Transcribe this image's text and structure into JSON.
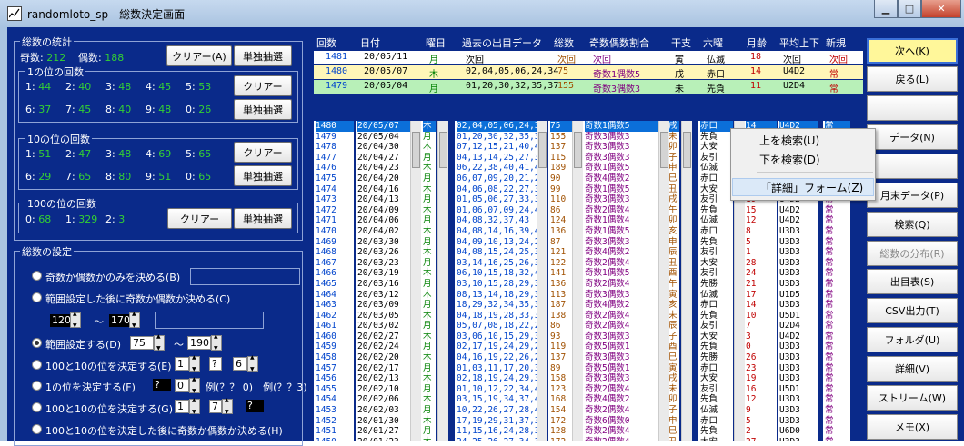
{
  "window": {
    "title": "randomloto_sp　総数決定画面"
  },
  "stats": {
    "group_title": "総数の統計",
    "odd_label": "奇数:",
    "odd_value": "212",
    "even_label": "偶数:",
    "even_value": "188",
    "clear_label": "クリアー(A)",
    "single_label": "単独抽選",
    "ones_title": "1の位の回数",
    "ones_row1": [
      [
        "1:",
        "44"
      ],
      [
        "2:",
        "40"
      ],
      [
        "3:",
        "48"
      ],
      [
        "4:",
        "45"
      ],
      [
        "5:",
        "53"
      ]
    ],
    "ones_row2": [
      [
        "6:",
        "37"
      ],
      [
        "7:",
        "45"
      ],
      [
        "8:",
        "40"
      ],
      [
        "9:",
        "48"
      ],
      [
        "0:",
        "26"
      ]
    ],
    "tens_title": "10の位の回数",
    "tens_row1": [
      [
        "1:",
        "51"
      ],
      [
        "2:",
        "47"
      ],
      [
        "3:",
        "48"
      ],
      [
        "4:",
        "69"
      ],
      [
        "5:",
        "65"
      ]
    ],
    "tens_row2": [
      [
        "6:",
        "29"
      ],
      [
        "7:",
        "65"
      ],
      [
        "8:",
        "80"
      ],
      [
        "9:",
        "51"
      ],
      [
        "0:",
        "65"
      ]
    ],
    "hund_title": "100の位の回数",
    "hund_row": [
      [
        "0:",
        "68"
      ],
      [
        "1:",
        "329"
      ],
      [
        "2:",
        "3"
      ]
    ],
    "clear2_label": "クリアー"
  },
  "settings": {
    "group_title": "総数の設定",
    "opt1": "奇数か偶数かのみを決める(B)",
    "opt2": "範囲設定した後に奇数か偶数か決める(C)",
    "opt2_from": "120",
    "opt2_to": "170",
    "tilde": "～",
    "opt3": "範囲設定する(D)",
    "opt3_from": "75",
    "opt3_to": "190",
    "opt4": "100と10の位を決定する(E)",
    "opt4_a": "1",
    "opt4_b": "?",
    "opt4_c": "6",
    "opt5": "1の位を決定する(F)",
    "opt5_a": "?",
    "opt5_b": "0",
    "opt5_ex": "例(？？ 0)　例(？？3)",
    "opt6": "100と10の位を決定する(G)",
    "opt6_a": "1",
    "opt6_b": "7",
    "opt6_c": "?",
    "opt7": "100と10の位を決定した後に奇数か偶数か決める(H)"
  },
  "headers": [
    "回数",
    "日付",
    "曜日",
    "過去の出目データ",
    "総数",
    "奇数偶数割合",
    "干支",
    "六曜",
    "月齢",
    "平均上下",
    "新規"
  ],
  "top_rows": [
    {
      "no": "1481",
      "date": "20/05/11",
      "wd": "月",
      "data": "次回",
      "sum": "次回",
      "ratio": "次回",
      "eto": "寅",
      "rokuyo": "仏滅",
      "age": "18",
      "avg": "次回",
      "new": "次回",
      "bg": "#ffffff"
    },
    {
      "no": "1480",
      "date": "20/05/07",
      "wd": "木",
      "data": "02,04,05,06,24,34",
      "sum": "75",
      "ratio": "奇数1偶数5",
      "eto": "戌",
      "rokuyo": "赤口",
      "age": "14",
      "avg": "U4D2",
      "new": "常",
      "bg": "#fff6b8"
    },
    {
      "no": "1479",
      "date": "20/05/04",
      "wd": "月",
      "data": "01,20,30,32,35,37",
      "sum": "155",
      "ratio": "奇数3偶数3",
      "eto": "未",
      "rokuyo": "先負",
      "age": "11",
      "avg": "U2D4",
      "new": "常",
      "bg": "#b8f0b8"
    }
  ],
  "list": {
    "no": [
      "1480",
      "1479",
      "1478",
      "1477",
      "1476",
      "1475",
      "1474",
      "1473",
      "1472",
      "1471",
      "1470",
      "1469",
      "1468",
      "1467",
      "1466",
      "1465",
      "1464",
      "1463",
      "1462",
      "1461",
      "1460",
      "1459",
      "1458",
      "1457",
      "1456",
      "1455",
      "1454",
      "1453",
      "1452",
      "1451",
      "1450",
      "1449"
    ],
    "date": [
      "20/05/07",
      "20/05/04",
      "20/04/30",
      "20/04/27",
      "20/04/23",
      "20/04/20",
      "20/04/16",
      "20/04/13",
      "20/04/09",
      "20/04/06",
      "20/04/02",
      "20/03/30",
      "20/03/26",
      "20/03/23",
      "20/03/19",
      "20/03/16",
      "20/03/12",
      "20/03/09",
      "20/03/05",
      "20/03/02",
      "20/02/27",
      "20/02/24",
      "20/02/20",
      "20/02/17",
      "20/02/13",
      "20/02/10",
      "20/02/06",
      "20/02/03",
      "20/01/30",
      "20/01/27",
      "20/01/23",
      "20/01/20"
    ],
    "wd": [
      "木",
      "月",
      "木",
      "月",
      "木",
      "月",
      "木",
      "月",
      "木",
      "月",
      "木",
      "月",
      "木",
      "月",
      "木",
      "月",
      "木",
      "月",
      "木",
      "月",
      "木",
      "月",
      "木",
      "月",
      "木",
      "月",
      "木",
      "月",
      "木",
      "月",
      "木",
      "月"
    ],
    "data": [
      "02,04,05,06,24,34",
      "01,20,30,32,35,37",
      "07,12,15,21,40,42",
      "04,13,14,25,27,32",
      "06,22,38,40,41,42",
      "06,07,09,20,21,27",
      "04,06,08,22,27,32",
      "01,05,06,27,33,38",
      "01,06,07,09,24,40",
      "04,08,32,37,43",
      "04,08,14,16,39,40",
      "04,09,10,13,24,27",
      "04,08,15,24,25,31",
      "03,14,16,25,26,38",
      "06,10,15,18,32,40",
      "03,10,15,28,29,30",
      "08,13,14,18,29,31",
      "18,29,32,34,35,39",
      "04,18,19,28,33,36",
      "05,07,08,18,22,26",
      "03,06,10,15,29,30",
      "02,17,19,24,29,29",
      "04,16,19,22,26,29",
      "01,03,11,17,20,37",
      "02,18,19,24,29,31",
      "01,10,12,22,34,43",
      "03,15,19,34,37,40",
      "10,22,26,27,28,41",
      "17,19,29,31,37,39",
      "11,15,16,24,28,34",
      "24,25,26,27,34,36",
      "04,05,07,16,27,40"
    ],
    "sum": [
      "75",
      "155",
      "137",
      "115",
      "189",
      "90",
      "99",
      "110",
      "86",
      "124",
      "136",
      "87",
      "121",
      "122",
      "141",
      "136",
      "113",
      "187",
      "138",
      "86",
      "93",
      "119",
      "137",
      "89",
      "158",
      "123",
      "168",
      "154",
      "172",
      "128",
      "172",
      "99"
    ],
    "ratio": [
      "奇数1偶数5",
      "奇数3偶数3",
      "奇数3偶数3",
      "奇数3偶数3",
      "奇数1偶数5",
      "奇数4偶数2",
      "奇数1偶数5",
      "奇数3偶数3",
      "奇数2偶数4",
      "奇数1偶数4",
      "奇数1偶数5",
      "奇数3偶数3",
      "奇数4偶数2",
      "奇数2偶数4",
      "奇数1偶数5",
      "奇数2偶数4",
      "奇数3偶数3",
      "奇数4偶数2",
      "奇数2偶数4",
      "奇数2偶数4",
      "奇数3偶数3",
      "奇数5偶数1",
      "奇数3偶数3",
      "奇数5偶数1",
      "奇数3偶数3",
      "奇数2偶数4",
      "奇数4偶数2",
      "奇数2偶数4",
      "奇数6偶数0",
      "奇数2偶数4",
      "奇数2偶数4",
      "奇数3偶数3"
    ],
    "eto": [
      "戌",
      "未",
      "卯",
      "子",
      "申",
      "巳",
      "丑",
      "戌",
      "午",
      "卯",
      "亥",
      "申",
      "辰",
      "丑",
      "酉",
      "午",
      "寅",
      "亥",
      "未",
      "辰",
      "子",
      "酉",
      "巳",
      "寅",
      "戌",
      "未",
      "卯",
      "子",
      "申",
      "巳",
      "丑",
      "戌"
    ],
    "rokuyo": [
      "赤口",
      "先負",
      "大安",
      "友引",
      "仏滅",
      "赤口",
      "大安",
      "友引",
      "先負",
      "仏滅",
      "赤口",
      "先負",
      "友引",
      "大安",
      "友引",
      "先勝",
      "仏滅",
      "赤口",
      "先負",
      "友引",
      "大安",
      "先負",
      "先勝",
      "赤口",
      "大安",
      "友引",
      "先負",
      "仏滅",
      "赤口",
      "先負",
      "大安",
      "友引"
    ],
    "age": [
      "14",
      "11",
      "7",
      "4",
      "0",
      "26",
      "22",
      "19",
      "15",
      "12",
      "8",
      "5",
      "1",
      "28",
      "24",
      "21",
      "17",
      "14",
      "10",
      "7",
      "3",
      "0",
      "26",
      "23",
      "19",
      "16",
      "12",
      "9",
      "5",
      "2",
      "27",
      "24"
    ],
    "avg": [
      "U4D2",
      "U2D4",
      "U2D4",
      "U4D2",
      "U4D2",
      "U4D2",
      "U4D2",
      "U4D2",
      "U4D2",
      "U4D2",
      "U3D3",
      "U3D3",
      "U3D3",
      "U3D3",
      "U3D3",
      "U3D3",
      "U1D5",
      "U3D3",
      "U5D1",
      "U2D4",
      "U4D2",
      "U3D3",
      "U3D3",
      "U3D3",
      "U3D3",
      "U5D1",
      "U3D3",
      "U3D3",
      "U3D3",
      "U6D0",
      "U3D3",
      "U4D2"
    ],
    "new": [
      "常",
      "常",
      "常",
      "常",
      "常",
      "常",
      "常",
      "常",
      "常",
      "常",
      "常",
      "常",
      "常",
      "常",
      "常",
      "常",
      "常",
      "常",
      "常",
      "常",
      "常",
      "常",
      "常",
      "常",
      "常",
      "常",
      "常",
      "常",
      "常",
      "常",
      "常",
      "常"
    ]
  },
  "buttons": [
    "次へ(K)",
    "戻る(L)",
    "",
    "データ(N)",
    "",
    "月末データ(P)",
    "検索(Q)",
    "総数の分布(R)",
    "出目表(S)",
    "CSV出力(T)",
    "フォルダ(U)",
    "詳細(V)",
    "ストリーム(W)",
    "メモ(X)"
  ],
  "menu": [
    "上を検索(U)",
    "下を検索(D)",
    "「詳細」フォーム(Z)"
  ]
}
